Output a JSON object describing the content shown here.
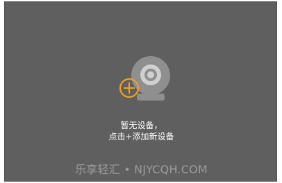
{
  "empty_state": {
    "line1": "暂无设备，",
    "line2": "点击+添加新设备"
  },
  "watermark": {
    "text": "乐享轻汇 • NJYCQH.COM"
  },
  "icons": {
    "camera": "webcam-icon",
    "add": "plus-circle-icon"
  },
  "colors": {
    "panel_bg": "#5f5f5f",
    "camera_gray": "#8f8f8f",
    "accent_orange": "#f0a020",
    "text": "#ffffff",
    "watermark": "#9c9c9c"
  }
}
